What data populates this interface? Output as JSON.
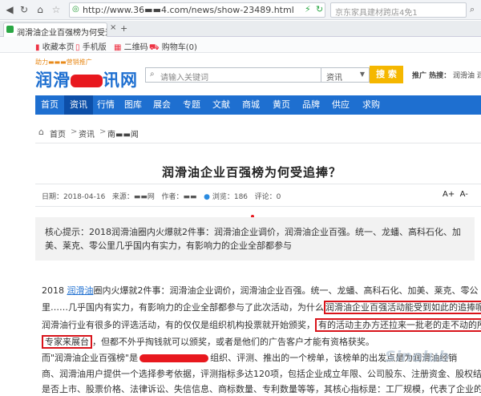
{
  "browser": {
    "url": "http://www.36▬▬4.com/news/show-23489.html",
    "search_placeholder": "京东家具建材跨店4免1",
    "tab_title": "润滑油企业百强榜为何受追捧？",
    "bookmarks": [
      "收藏本页",
      "手机版",
      "二维码",
      "购物车(0)"
    ]
  },
  "site": {
    "logo_tagline": "助力▬▬▬营销推广",
    "logo_text_a": "润滑",
    "logo_text_b": "讯网",
    "search_placeholder": "请输入关键词",
    "search_category": "资讯",
    "search_button": "搜 索",
    "hot_label": "推广 热搜：",
    "hot_items": "润滑油  润滑"
  },
  "nav": [
    "首页",
    "资讯",
    "行情",
    "图库",
    "展会",
    "专题",
    "文献",
    "商城",
    "黄页",
    "品牌",
    "供应",
    "求购"
  ],
  "breadcrumb": [
    "首页",
    "资讯",
    "南▬▬闻"
  ],
  "article": {
    "title": "润滑油企业百强榜为何受追捧？",
    "date": "日期：2018-04-16",
    "source": "来源：▬▬网",
    "author": "作者：▬▬",
    "views": "浏览：186",
    "comments": "评论：0",
    "font_large": "A+",
    "font_small": "A-",
    "summary": "核心提示：2018润滑油圈内火爆就2件事：润滑油企业调价，润滑油企业百强。统一、龙蟠、高科石化、加美、莱克、零公里几乎国内有实力，有影响力的企业全部都参与",
    "p1_a": "2018 ",
    "p1_link": "润滑油",
    "p1_b": "圈内火爆就2件事：润滑油企业调价，润滑油企业百强。统一、龙蟠、高科石化、加美、莱克、零公",
    "p2_a": "里……几乎国内有实力，有影响力的企业全部都参与了此次活动，为什么",
    "p2_box": "润滑油企业百强活动能受到如此的追捧呢？",
    "p3_a": "润滑油行业有很多的评选活动，有的仅仅是组织机构投票就开始颁奖，",
    "p3_box": "有的活动主办方还拉来一批老的走不动的所谓",
    "p4_box": "专家来展台",
    "p4_a": "，但都不外乎掏钱就可以颁奖，或者是他们的广告客户才能有资格获奖。",
    "p5_a": "而\"润滑油企业百强榜\"是",
    "p5_b": "组织、评测、推出的一个榜单，该榜单的出发点是为润滑油经销",
    "p6": "商、润滑油用户提供一个选择参考依据，评测指标多达120项，包括企业成立年限、公司股东、注册资金、股权结构、",
    "p7": "是否上市、股票价格、法律诉讼、失信信息、商标数量、专利数量等等，其核心指标是：工厂规模，代表了企业的硬"
  },
  "watermark": "Sinolub"
}
